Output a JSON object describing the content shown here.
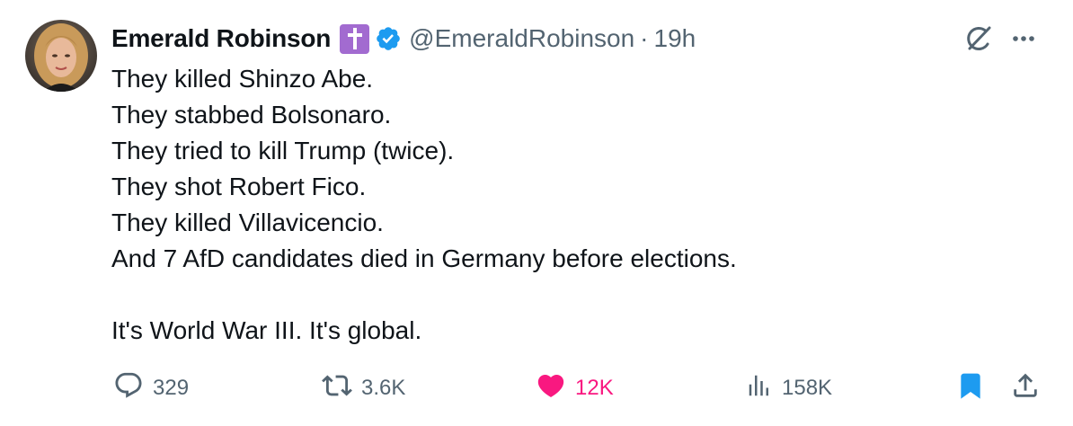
{
  "tweet": {
    "display_name": "Emerald Robinson",
    "handle": "@EmeraldRobinson",
    "separator": "·",
    "time": "19h",
    "badge_icon": "latin-cross-icon",
    "verified_color": "#1d9bf0",
    "lines": [
      "They killed Shinzo Abe.",
      "They stabbed Bolsonaro.",
      "They tried to kill Trump (twice).",
      "They shot Robert Fico.",
      "They killed Villavicencio.",
      "And 7 AfD candidates died in Germany before elections.",
      "",
      "It's World War III. It's global."
    ]
  },
  "actions": {
    "replies": "329",
    "reposts": "3.6K",
    "likes": "12K",
    "views": "158K",
    "liked": true,
    "bookmarked": true,
    "like_color": "#f91880",
    "bookmark_color": "#1d9bf0",
    "muted_color": "#536471"
  }
}
